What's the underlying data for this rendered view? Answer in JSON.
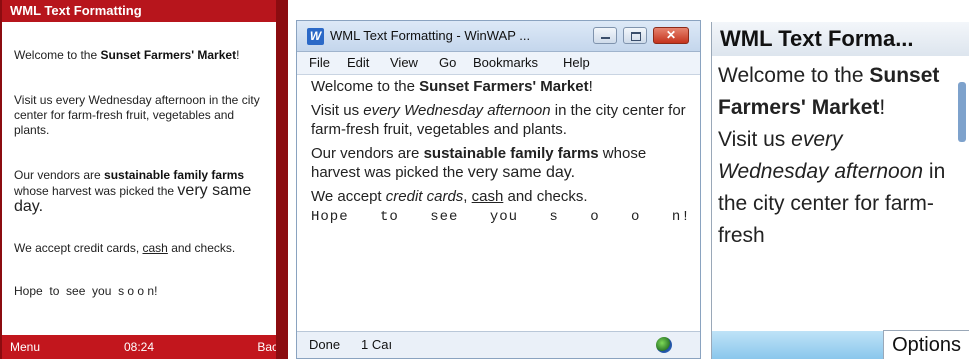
{
  "phone_browser": {
    "title": "WML Text Formatting",
    "welcome": "Welcome to the ",
    "market_name": "Sunset Farmers' Market",
    "exclaim": "!",
    "visit": "Visit us every Wednesday afternoon in the city center for farm-fresh fruit, vegetables and plants.",
    "vendors_pre": "Our vendors are ",
    "vendors_bold": "sustainable family farms",
    "vendors_post": " whose harvest was picked the ",
    "same_day": "very same day.",
    "accept_pre": "We accept credit cards, ",
    "cash": "cash",
    "accept_post": " and checks.",
    "hope": "Hope  to  see  you  s o o n!",
    "softkey_left": "Menu",
    "clock": "08:24",
    "softkey_right": "Back"
  },
  "desktop_browser": {
    "title": "WML Text Formatting - WinWAP ...",
    "menu": {
      "file": "File",
      "edit": "Edit",
      "view": "View",
      "go": "Go",
      "bookmarks": "Bookmarks",
      "help": "Help"
    },
    "welcome": "Welcome to the ",
    "market_name": "Sunset Farmers' Market",
    "exclaim": "!",
    "visit_pre": "Visit us ",
    "visit_italic": "every Wednesday afternoon",
    "visit_post": " in the city center for farm-fresh fruit, vegetables and plants.",
    "vendors_pre": "Our vendors are ",
    "vendors_bold": "sustainable family farms",
    "vendors_post": " whose harvest was picked the ",
    "same_day": "very same day.",
    "accept_pre": "We accept ",
    "credit_cards": "credit cards",
    "comma": ", ",
    "cash": "cash",
    "accept_post": " and checks.",
    "hope": "Hope to see you s o o n!",
    "status_done": "Done",
    "status_count": "1 Caı"
  },
  "device_browser": {
    "title": "WML Text Forma...",
    "welcome": "Welcome to the ",
    "market_name": "Sunset Farmers' Market",
    "exclaim": "!",
    "visit_pre": "Visit us ",
    "visit_italic": "every Wednesday afternoon",
    "visit_post": " in the city center for farm-fresh",
    "softkey_options": "Options"
  }
}
